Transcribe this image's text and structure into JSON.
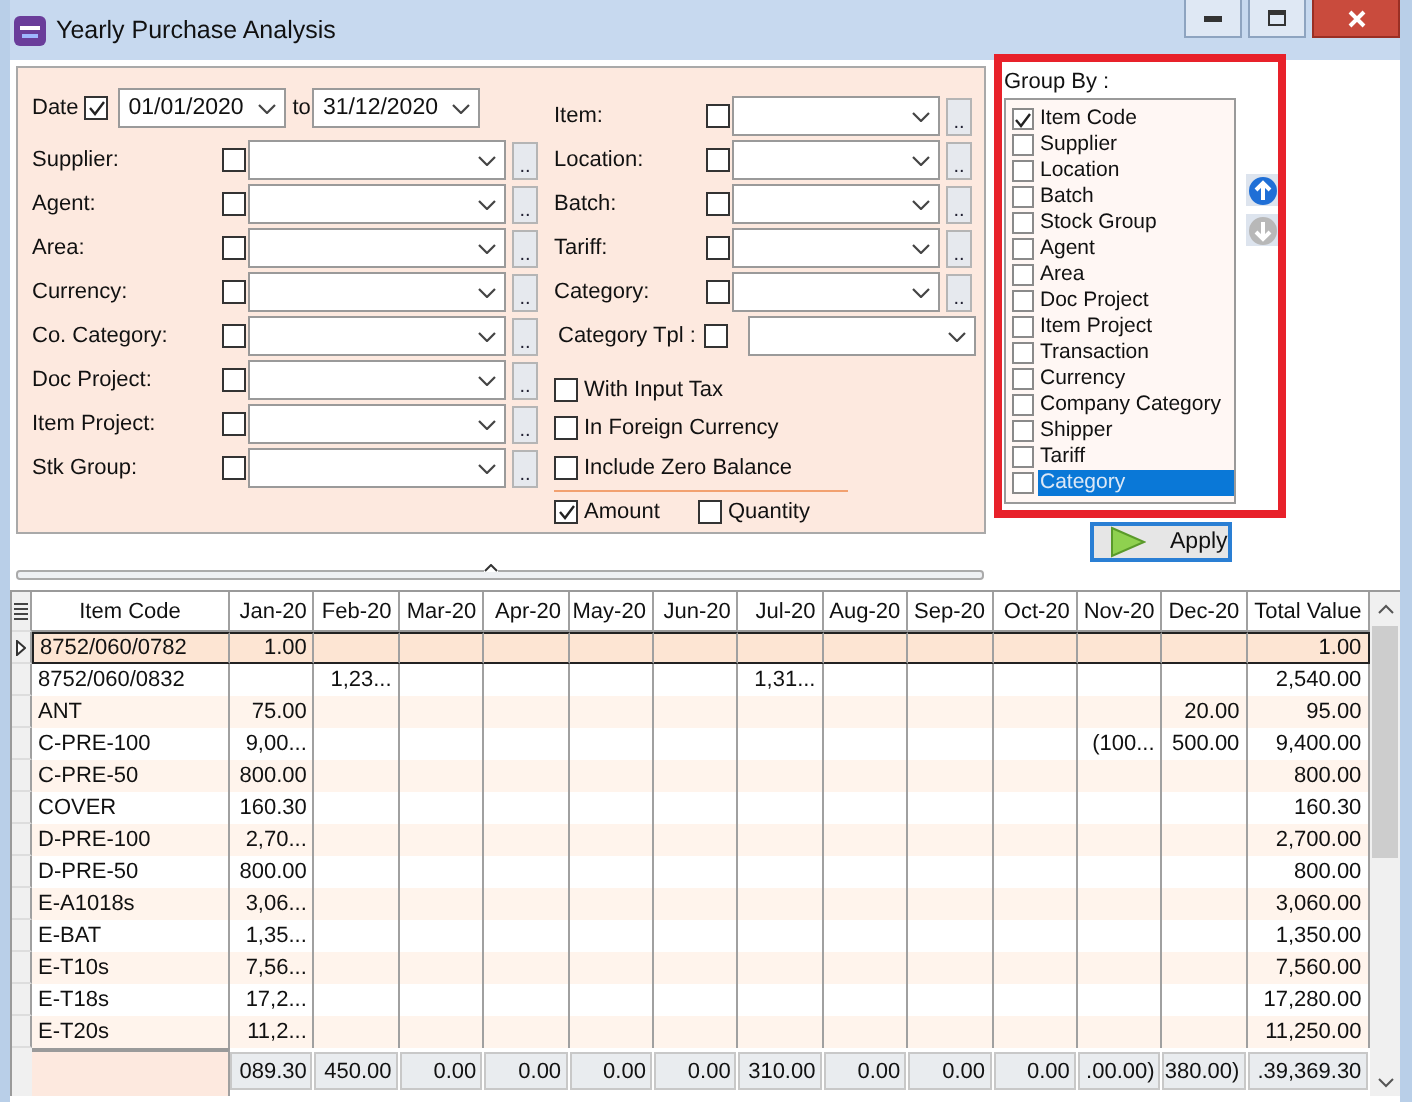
{
  "window": {
    "title": "Yearly Purchase Analysis"
  },
  "date_filter": {
    "label": "Date",
    "checked": true,
    "from": "01/01/2020",
    "to_label": "to",
    "to": "31/12/2020"
  },
  "left_filters": [
    {
      "label": "Supplier:",
      "checked": false,
      "button": ".."
    },
    {
      "label": "Agent:",
      "checked": false,
      "button": ".."
    },
    {
      "label": "Area:",
      "checked": false,
      "button": ".."
    },
    {
      "label": "Currency:",
      "checked": false,
      "button": ".."
    },
    {
      "label": "Co. Category:",
      "checked": false,
      "button": ".."
    },
    {
      "label": "Doc Project:",
      "checked": false,
      "button": ".."
    },
    {
      "label": "Item Project:",
      "checked": false,
      "button": ".."
    },
    {
      "label": "Stk Group:",
      "checked": false,
      "button": ".."
    }
  ],
  "right_filters": [
    {
      "label": "Item:",
      "checked": false,
      "button": ".."
    },
    {
      "label": "Location:",
      "checked": false,
      "button": ".."
    },
    {
      "label": "Batch:",
      "checked": false,
      "button": ".."
    },
    {
      "label": "Tariff:",
      "checked": false,
      "button": ".."
    },
    {
      "label": "Category:",
      "checked": false,
      "button": ".."
    }
  ],
  "category_tpl": {
    "label": "Category Tpl :",
    "checked": false
  },
  "options": [
    {
      "label": "With Input Tax",
      "checked": false
    },
    {
      "label": "In Foreign Currency",
      "checked": false
    },
    {
      "label": "Include Zero Balance",
      "checked": false
    }
  ],
  "value_options": [
    {
      "label": "Amount",
      "checked": true
    },
    {
      "label": "Quantity",
      "checked": false
    }
  ],
  "group_by": {
    "title": "Group By :",
    "items": [
      {
        "label": "Item Code",
        "checked": true,
        "selected": false
      },
      {
        "label": "Supplier",
        "checked": false,
        "selected": false
      },
      {
        "label": "Location",
        "checked": false,
        "selected": false
      },
      {
        "label": "Batch",
        "checked": false,
        "selected": false
      },
      {
        "label": "Stock Group",
        "checked": false,
        "selected": false
      },
      {
        "label": "Agent",
        "checked": false,
        "selected": false
      },
      {
        "label": "Area",
        "checked": false,
        "selected": false
      },
      {
        "label": "Doc Project",
        "checked": false,
        "selected": false
      },
      {
        "label": "Item Project",
        "checked": false,
        "selected": false
      },
      {
        "label": "Transaction",
        "checked": false,
        "selected": false
      },
      {
        "label": "Currency",
        "checked": false,
        "selected": false
      },
      {
        "label": "Company Category",
        "checked": false,
        "selected": false
      },
      {
        "label": "Shipper",
        "checked": false,
        "selected": false
      },
      {
        "label": "Tariff",
        "checked": false,
        "selected": false
      },
      {
        "label": "Category",
        "checked": false,
        "selected": true
      }
    ]
  },
  "apply_button": {
    "label": "Apply"
  },
  "grid": {
    "columns": [
      "Item Code",
      "Jan-20",
      "Feb-20",
      "Mar-20",
      "Apr-20",
      "May-20",
      "Jun-20",
      "Jul-20",
      "Aug-20",
      "Sep-20",
      "Oct-20",
      "Nov-20",
      "Dec-20",
      "Total Value"
    ],
    "rows": [
      {
        "item_code": "8752/060/0782",
        "jan": "1.00",
        "total": "1.00",
        "selected": true
      },
      {
        "item_code": "8752/060/0832",
        "feb": "1,23...",
        "jul": "1,31...",
        "total": "2,540.00",
        "selected": false
      },
      {
        "item_code": "ANT",
        "jan": "75.00",
        "dec": "20.00",
        "total": "95.00",
        "selected": false
      },
      {
        "item_code": "C-PRE-100",
        "jan": "9,00...",
        "nov": "(100...",
        "dec": "500.00",
        "total": "9,400.00",
        "selected": false
      },
      {
        "item_code": "C-PRE-50",
        "jan": "800.00",
        "total": "800.00",
        "selected": false
      },
      {
        "item_code": "COVER",
        "jan": "160.30",
        "total": "160.30",
        "selected": false
      },
      {
        "item_code": "D-PRE-100",
        "jan": "2,70...",
        "total": "2,700.00",
        "selected": false
      },
      {
        "item_code": "D-PRE-50",
        "jan": "800.00",
        "total": "800.00",
        "selected": false
      },
      {
        "item_code": "E-A1018s",
        "jan": "3,06...",
        "total": "3,060.00",
        "selected": false
      },
      {
        "item_code": "E-BAT",
        "jan": "1,35...",
        "total": "1,350.00",
        "selected": false
      },
      {
        "item_code": "E-T10s",
        "jan": "7,56...",
        "total": "7,560.00",
        "selected": false
      },
      {
        "item_code": "E-T18s",
        "jan": "17,2...",
        "total": "17,280.00",
        "selected": false
      },
      {
        "item_code": "E-T20s",
        "jan": "11,2...",
        "total": "11,250.00",
        "selected": false
      }
    ],
    "totals": [
      "089.30",
      "450.00",
      "0.00",
      "0.00",
      "0.00",
      "0.00",
      "310.00",
      "0.00",
      "0.00",
      "0.00",
      ".00.00)",
      "380.00)",
      ".39,369.30"
    ]
  }
}
